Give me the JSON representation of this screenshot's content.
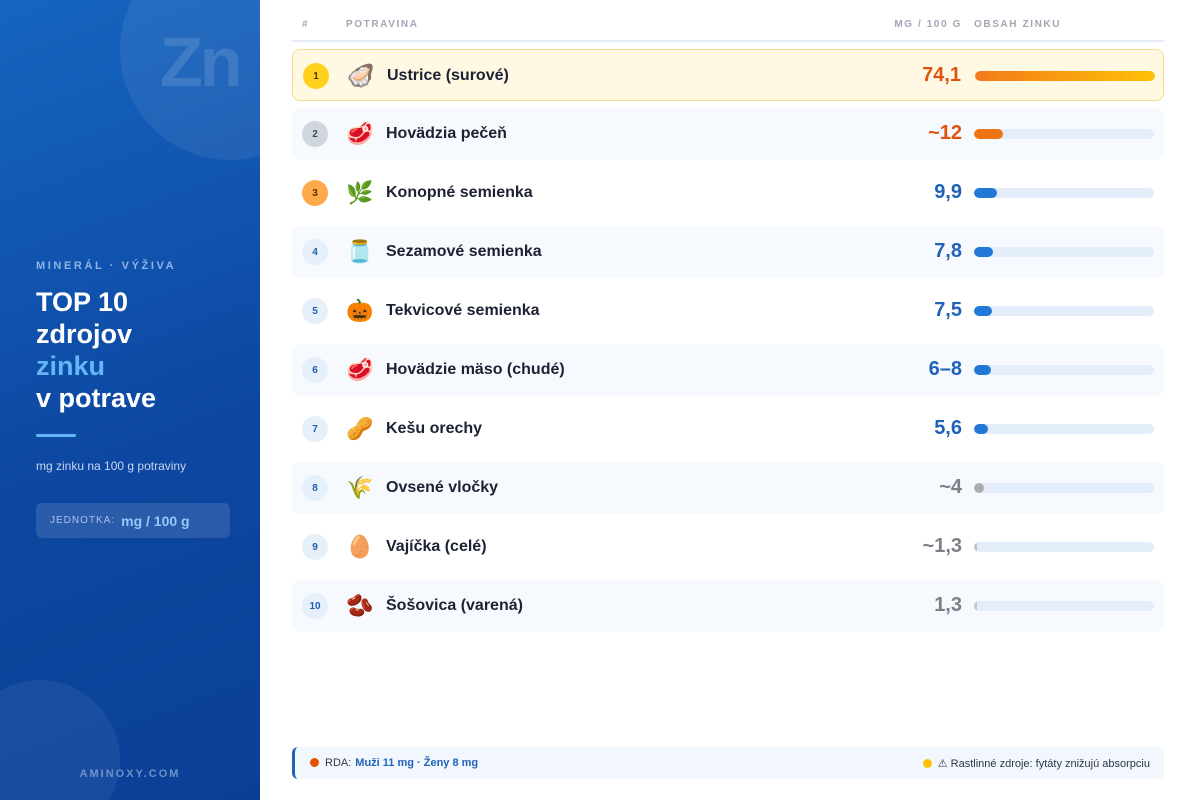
{
  "sidebar": {
    "watermark": "Zn",
    "eyebrow": "MINERÁL · VÝŽIVA",
    "title_line1": "TOP 10",
    "title_line2": "zdrojov",
    "title_line3": "zinku",
    "title_line4": "v potrave",
    "subtitle": "mg zinku na 100 g potraviny",
    "unit_label": "JEDNOTKA:",
    "unit_value": "mg / 100 g",
    "brand": "AMINOXY.COM",
    "colors": {
      "accent": "#64b5f6",
      "background": "#0d47a1"
    }
  },
  "table": {
    "headers": {
      "rank": "#",
      "food": "POTRAVINA",
      "mg": "MG / 100 G",
      "bar": "OBSAH ZINKU"
    },
    "rows": [
      {
        "rank": "1",
        "icon": "oyster-icon",
        "glyph": "🦪",
        "name": "Ustrice (surové)",
        "mg": "74,1",
        "fill": 1.0
      },
      {
        "rank": "2",
        "icon": "meat-icon",
        "glyph": "🥩",
        "name": "Hovädzia pečeň",
        "mg": "~12",
        "fill": 0.16
      },
      {
        "rank": "3",
        "icon": "herb-icon",
        "glyph": "🌿",
        "name": "Konopné semienka",
        "mg": "9,9",
        "fill": 0.13
      },
      {
        "rank": "4",
        "icon": "jar-icon",
        "glyph": "🫙",
        "name": "Sezamové semienka",
        "mg": "7,8",
        "fill": 0.105
      },
      {
        "rank": "5",
        "icon": "pumpkin-icon",
        "glyph": "🎃",
        "name": "Tekvicové semienka",
        "mg": "7,5",
        "fill": 0.1
      },
      {
        "rank": "6",
        "icon": "meat-icon",
        "glyph": "🥩",
        "name": "Hovädzie mäso (chudé)",
        "mg": "6–8",
        "fill": 0.094
      },
      {
        "rank": "7",
        "icon": "peanut-icon",
        "glyph": "🥜",
        "name": "Kešu orechy",
        "mg": "5,6",
        "fill": 0.075
      },
      {
        "rank": "8",
        "icon": "wheat-icon",
        "glyph": "🌾",
        "name": "Ovsené vločky",
        "mg": "~4",
        "fill": 0.054
      },
      {
        "rank": "9",
        "icon": "egg-icon",
        "glyph": "🥚",
        "name": "Vajíčka (celé)",
        "mg": "~1,3",
        "fill": 0.018
      },
      {
        "rank": "10",
        "icon": "beans-icon",
        "glyph": "🫘",
        "name": "Šošovica (varená)",
        "mg": "1,3",
        "fill": 0.018
      }
    ]
  },
  "footer": {
    "rda_label": "RDA:",
    "rda_value": "Muži 11 mg · Ženy 8 mg",
    "note": "⚠ Rastlinné zdroje: fytáty znižujú absorpciu"
  }
}
